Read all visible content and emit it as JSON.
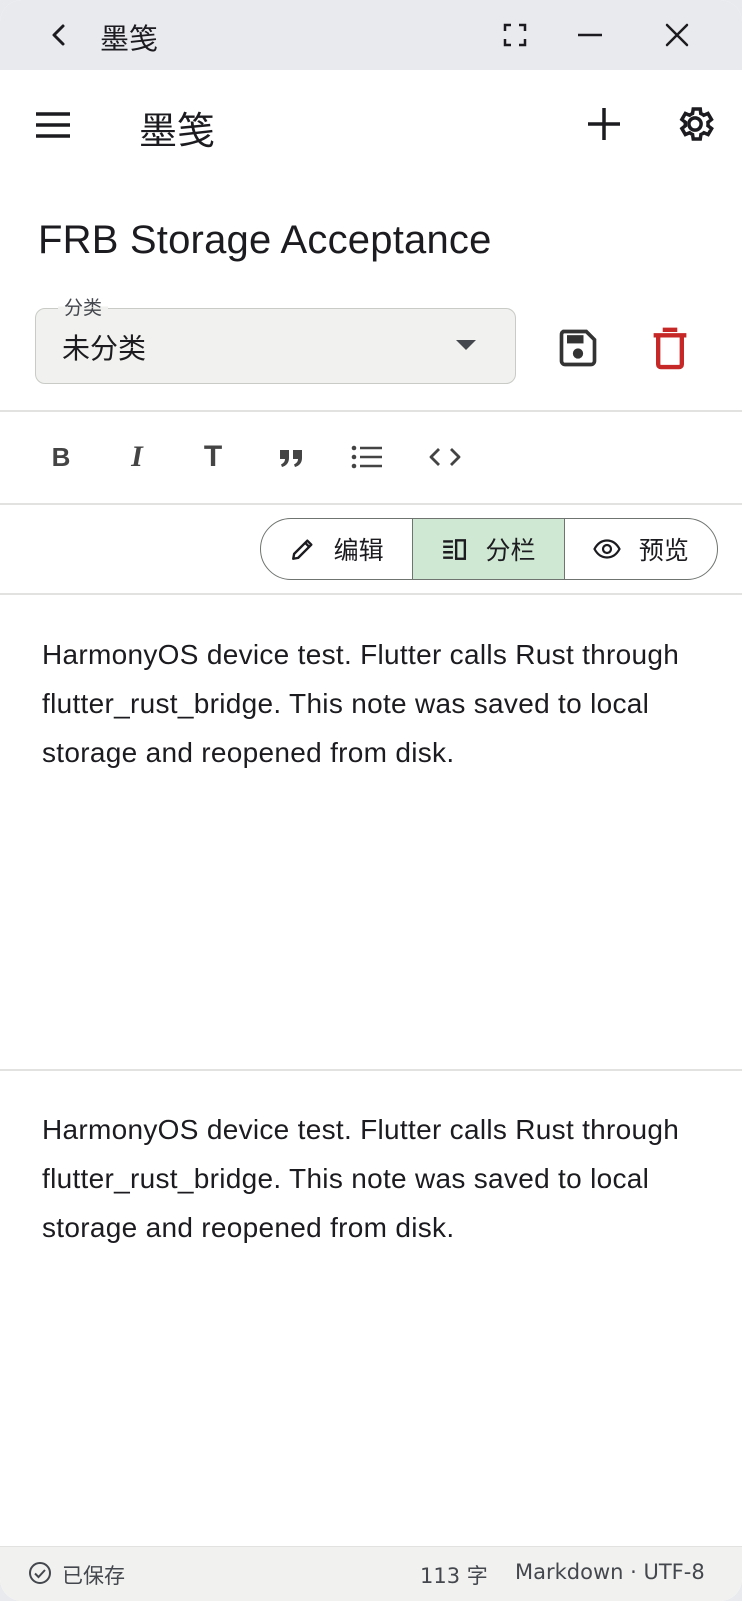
{
  "window": {
    "title": "墨笺"
  },
  "appbar": {
    "title": "墨笺"
  },
  "note": {
    "title": "FRB Storage Acceptance",
    "category_label": "分类",
    "category_value": "未分类",
    "editor_text": "HarmonyOS device test. Flutter calls Rust through flutter_rust_bridge. This note was saved to local storage and reopened from disk.",
    "preview_text": "HarmonyOS device test. Flutter calls Rust through flutter_rust_bridge. This note was saved to local storage and reopened from disk."
  },
  "toolbar": {
    "bold": "B",
    "italic": "I",
    "heading": "T"
  },
  "view_mode": {
    "edit_label": "编辑",
    "split_label": "分栏",
    "preview_label": "预览",
    "selected": "split"
  },
  "status": {
    "saved": "已保存",
    "count": "113 字",
    "format": "Markdown · UTF-8"
  },
  "colors": {
    "accent_selected": "#cfe8d3",
    "delete": "#c62828"
  },
  "icons": [
    "back-icon",
    "maximize-icon",
    "minimize-icon",
    "close-icon",
    "menu-icon",
    "add-icon",
    "settings-icon",
    "dropdown-arrow-icon",
    "save-icon",
    "delete-icon",
    "quote-icon",
    "list-icon",
    "code-icon",
    "pencil-icon",
    "split-icon",
    "eye-icon",
    "check-circle-icon"
  ]
}
